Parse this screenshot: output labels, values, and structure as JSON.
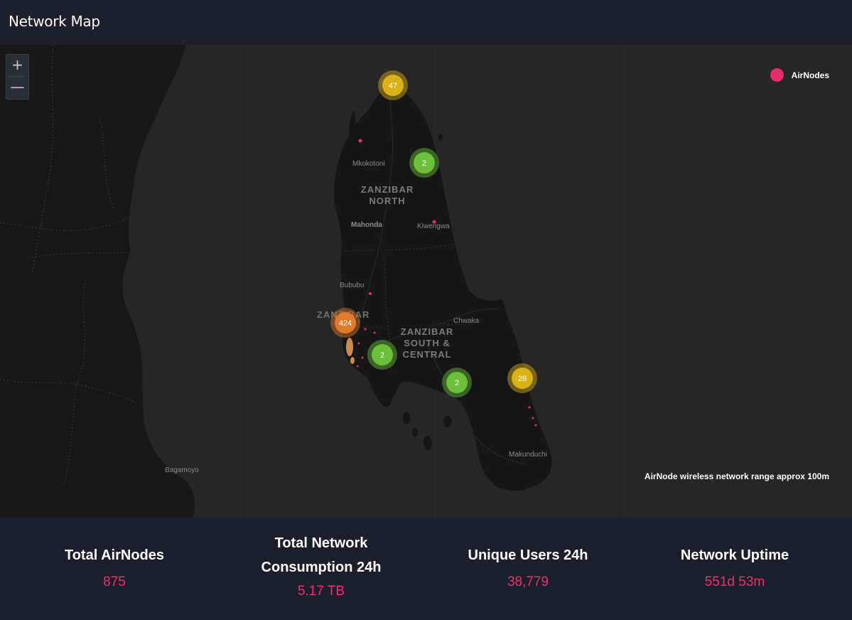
{
  "header": {
    "title": "Network Map"
  },
  "map": {
    "zoom_in_label": "+",
    "zoom_out_label": "—",
    "legend_label": "AirNodes",
    "range_note": "AirNode wireless network range approx 100m",
    "places": {
      "mkokotoni": "Mkokotoni",
      "zanzibar_north_1": "ZANZIBAR",
      "zanzibar_north_2": "NORTH",
      "mahonda": "Mahonda",
      "kiwengwa": "Kiwengwa",
      "bububu": "Bububu",
      "zanzibar_city": "ZANZIBAR",
      "chwaka": "Chwaka",
      "zsc_1": "ZANZIBAR",
      "zsc_2": "SOUTH &",
      "zsc_3": "CENTRAL",
      "makunduchi": "Makunduchi",
      "bagamoyo": "Bagamoyo"
    },
    "clusters": [
      {
        "count": "47",
        "color": "#d9b21a"
      },
      {
        "count": "2",
        "color": "#6cbf3a"
      },
      {
        "count": "424",
        "color": "#e07a2e"
      },
      {
        "count": "2",
        "color": "#6cbf3a"
      },
      {
        "count": "2",
        "color": "#6cbf3a"
      },
      {
        "count": "28",
        "color": "#d9b21a"
      }
    ]
  },
  "stats": [
    {
      "title": "Total AirNodes",
      "value": "875"
    },
    {
      "title_line1": "Total Network",
      "title_line2": "Consumption 24h",
      "value": "5.17 TB"
    },
    {
      "title": "Unique Users 24h",
      "value": "38,779"
    },
    {
      "title": "Network Uptime",
      "value": "551d 53m"
    }
  ],
  "colors": {
    "accent": "#e8336f",
    "airnode": "#e62e6e"
  }
}
